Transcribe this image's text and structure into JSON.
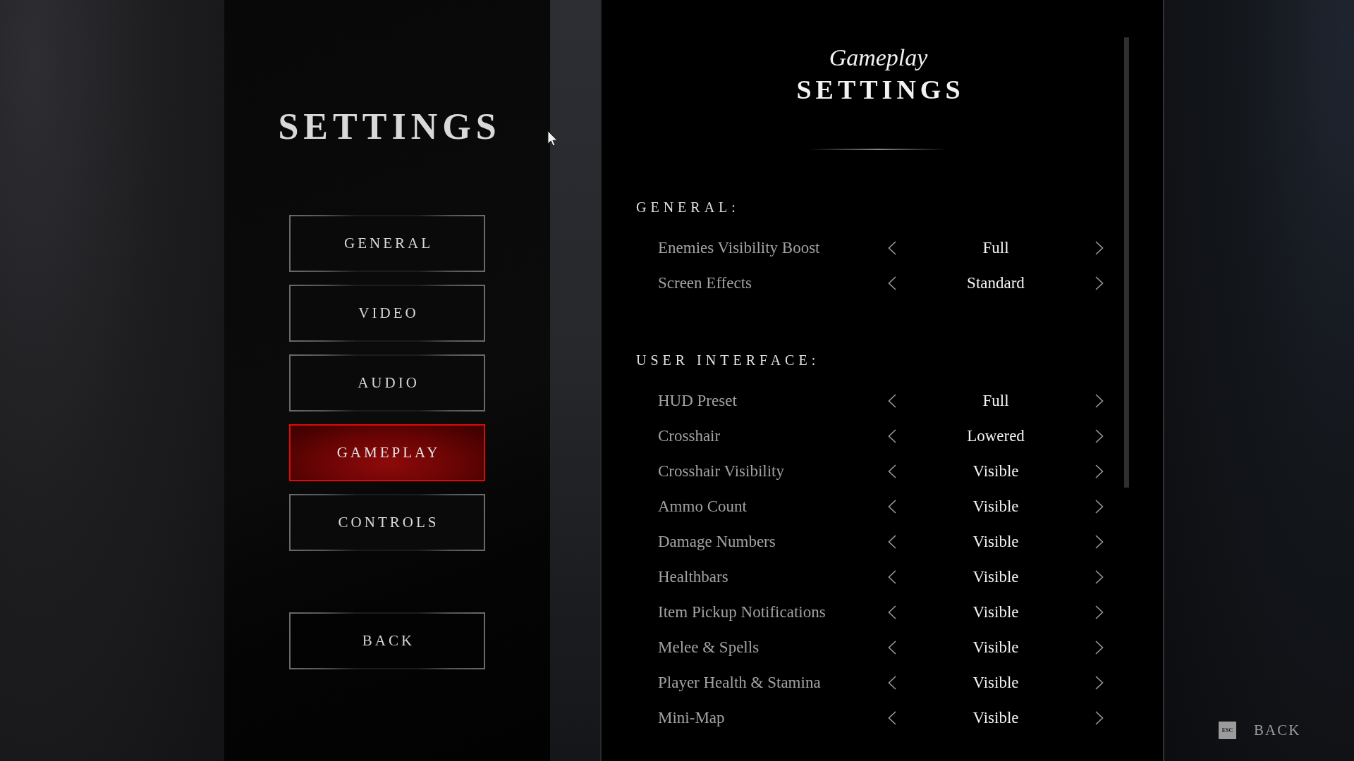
{
  "menu": {
    "title": "SETTINGS",
    "items": [
      {
        "label": "GENERAL",
        "selected": false
      },
      {
        "label": "VIDEO",
        "selected": false
      },
      {
        "label": "AUDIO",
        "selected": false
      },
      {
        "label": "GAMEPLAY",
        "selected": true
      },
      {
        "label": "CONTROLS",
        "selected": false
      }
    ],
    "back_button": "BACK"
  },
  "panel": {
    "subtitle": "Gameplay",
    "title": "SETTINGS",
    "sections": [
      {
        "heading": "GENERAL:",
        "options": [
          {
            "label": "Enemies Visibility Boost",
            "value": "Full"
          },
          {
            "label": "Screen Effects",
            "value": "Standard"
          }
        ]
      },
      {
        "heading": "USER INTERFACE:",
        "options": [
          {
            "label": "HUD Preset",
            "value": "Full"
          },
          {
            "label": "Crosshair",
            "value": "Lowered"
          },
          {
            "label": "Crosshair Visibility",
            "value": "Visible"
          },
          {
            "label": "Ammo Count",
            "value": "Visible"
          },
          {
            "label": "Damage Numbers",
            "value": "Visible"
          },
          {
            "label": "Healthbars",
            "value": "Visible"
          },
          {
            "label": "Item Pickup Notifications",
            "value": "Visible"
          },
          {
            "label": "Melee & Spells",
            "value": "Visible"
          },
          {
            "label": "Player Health & Stamina",
            "value": "Visible"
          },
          {
            "label": "Mini-Map",
            "value": "Visible"
          }
        ]
      }
    ]
  },
  "footer": {
    "key": "ESC",
    "action": "BACK"
  }
}
